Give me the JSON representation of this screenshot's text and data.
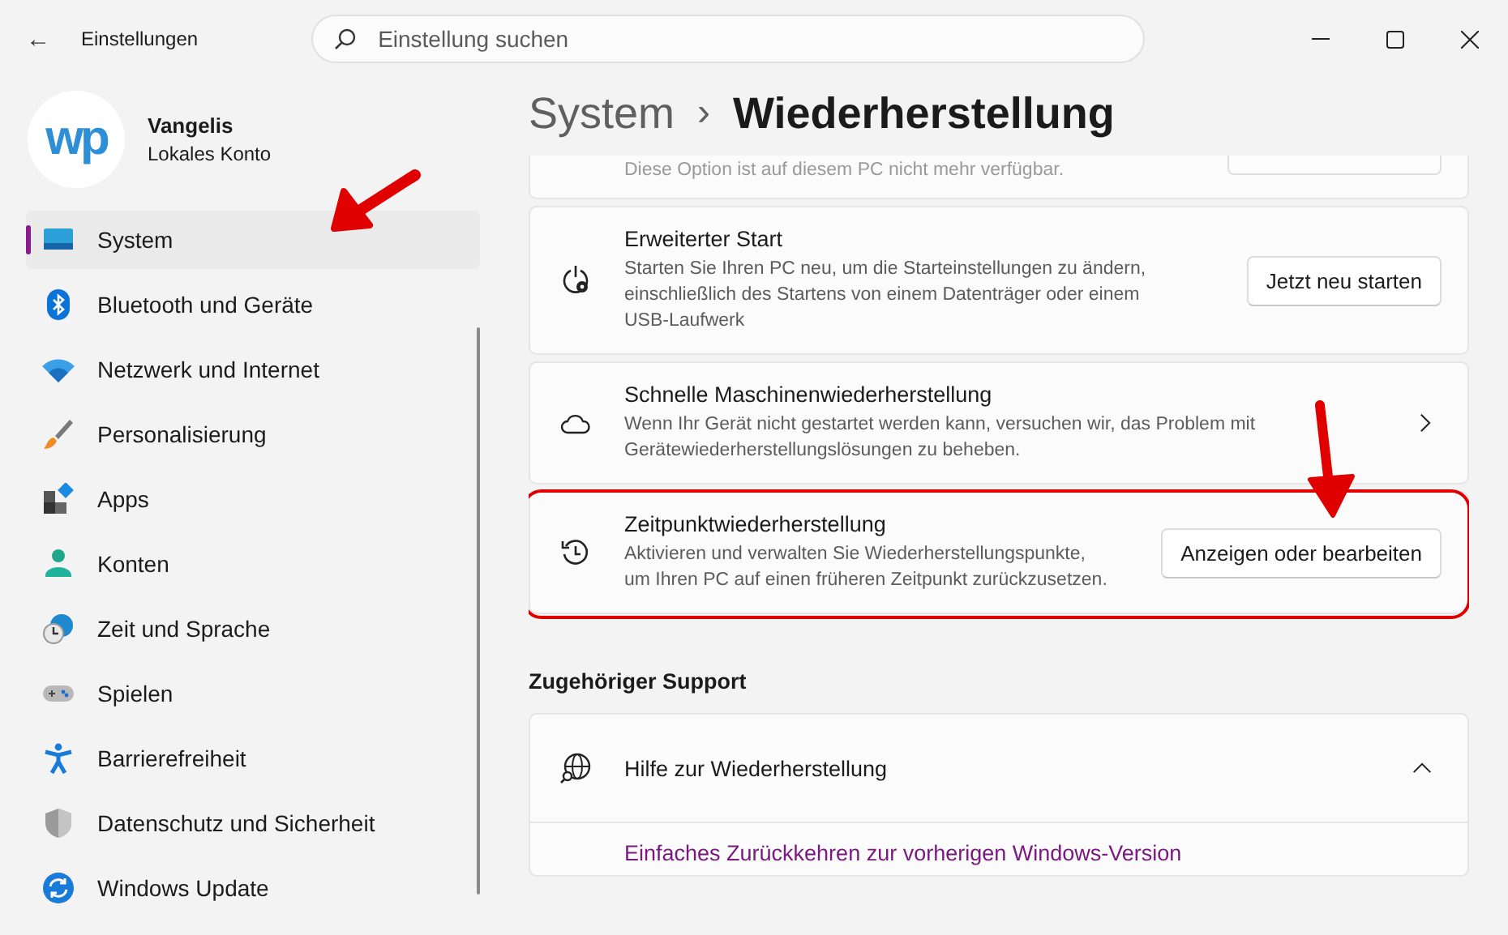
{
  "window": {
    "title": "Einstellungen",
    "back": "←"
  },
  "search": {
    "placeholder": "Einstellung suchen"
  },
  "profile": {
    "avatar_text": "wp",
    "name": "Vangelis",
    "account": "Lokales Konto"
  },
  "sidebar": {
    "items": [
      {
        "label": "System",
        "selected": true
      },
      {
        "label": "Bluetooth und Geräte",
        "selected": false
      },
      {
        "label": "Netzwerk und Internet",
        "selected": false
      },
      {
        "label": "Personalisierung",
        "selected": false
      },
      {
        "label": "Apps",
        "selected": false
      },
      {
        "label": "Konten",
        "selected": false
      },
      {
        "label": "Zeit und Sprache",
        "selected": false
      },
      {
        "label": "Spielen",
        "selected": false
      },
      {
        "label": "Barrierefreiheit",
        "selected": false
      },
      {
        "label": "Datenschutz und Sicherheit",
        "selected": false
      },
      {
        "label": "Windows Update",
        "selected": false
      }
    ]
  },
  "breadcrumb": {
    "parent": "System",
    "separator": "›",
    "current": "Wiederherstellung"
  },
  "cards": [
    {
      "kind": "partial",
      "description": "Diese Option ist auf diesem PC nicht mehr verfügbar.",
      "disabled": true
    },
    {
      "kind": "button",
      "title": "Erweiterter Start",
      "description": "Starten Sie Ihren PC neu, um die Starteinstellungen zu ändern, einschließlich des Startens von einem Datenträger oder einem USB-Laufwerk",
      "button": "Jetzt neu starten",
      "highlighted": false
    },
    {
      "kind": "chevron",
      "title": "Schnelle Maschinenwiederherstellung",
      "description": "Wenn Ihr Gerät nicht gestartet werden kann, versuchen wir, das Problem mit Gerätewiederherstellungslösungen zu beheben.",
      "highlighted": false
    },
    {
      "kind": "button",
      "title": "Zeitpunktwiederherstellung",
      "description": "Aktivieren und verwalten Sie Wiederherstellungspunkte, um Ihren PC auf einen früheren Zeitpunkt zurückzusetzen.",
      "button": "Anzeigen oder bearbeiten",
      "highlighted": true
    }
  ],
  "support": {
    "heading": "Zugehöriger Support",
    "title": "Hilfe zur Wiederherstellung",
    "expanded": true,
    "links": [
      "Einfaches Zurückkehren zur vorherigen Windows-Version"
    ]
  }
}
